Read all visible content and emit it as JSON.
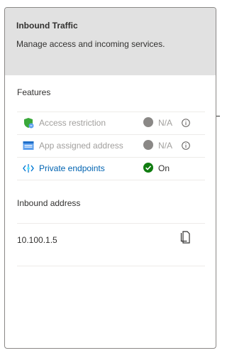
{
  "header": {
    "title": "Inbound Traffic",
    "subtitle": "Manage access and incoming services."
  },
  "features": {
    "title": "Features",
    "items": [
      {
        "label": "Access restriction",
        "icon": "shield-icon",
        "status": "N/A",
        "status_icon": "gray-dot-icon",
        "info_icon": "info-icon",
        "enabled": false
      },
      {
        "label": "App assigned address",
        "icon": "app-address-icon",
        "status": "N/A",
        "status_icon": "gray-dot-icon",
        "info_icon": "info-icon",
        "enabled": false
      },
      {
        "label": "Private endpoints",
        "icon": "private-endpoint-icon",
        "status": "On",
        "status_icon": "green-check-icon",
        "enabled": true
      }
    ]
  },
  "inbound": {
    "title": "Inbound address",
    "address": "10.100.1.5",
    "copy_icon": "copy-icon"
  },
  "colors": {
    "header_bg": "#e1e1e1",
    "link": "#0063b1",
    "disabled_text": "#a19f9d",
    "status_gray": "#8a8886",
    "status_green": "#107c10"
  }
}
